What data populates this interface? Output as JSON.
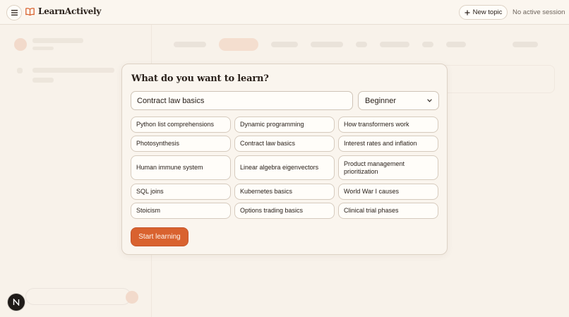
{
  "app": {
    "name": "LearnActively"
  },
  "header": {
    "new_topic_label": "New topic",
    "session_status": "No active session"
  },
  "icons": {
    "menu": "menu-icon",
    "brand": "book-open-icon",
    "plus": "plus-icon",
    "chevron": "chevron-down-icon",
    "badge": "n-logo-icon"
  },
  "colors": {
    "accent": "#d9622f",
    "background": "#f8f2ea",
    "text": "#2a211b"
  },
  "modal": {
    "title": "What do you want to learn?",
    "topic_value": "Contract law basics",
    "level_selected": "Beginner",
    "suggestions": [
      "Python list comprehensions",
      "Dynamic programming",
      "How transformers work",
      "Photosynthesis",
      "Contract law basics",
      "Interest rates and inflation",
      "Human immune system",
      "Linear algebra eigenvectors",
      "Product management prioritization",
      "SQL joins",
      "Kubernetes basics",
      "World War I causes",
      "Stoicism",
      "Options trading basics",
      "Clinical trial phases"
    ],
    "start_label": "Start learning"
  },
  "badge": {
    "letter": "N"
  }
}
